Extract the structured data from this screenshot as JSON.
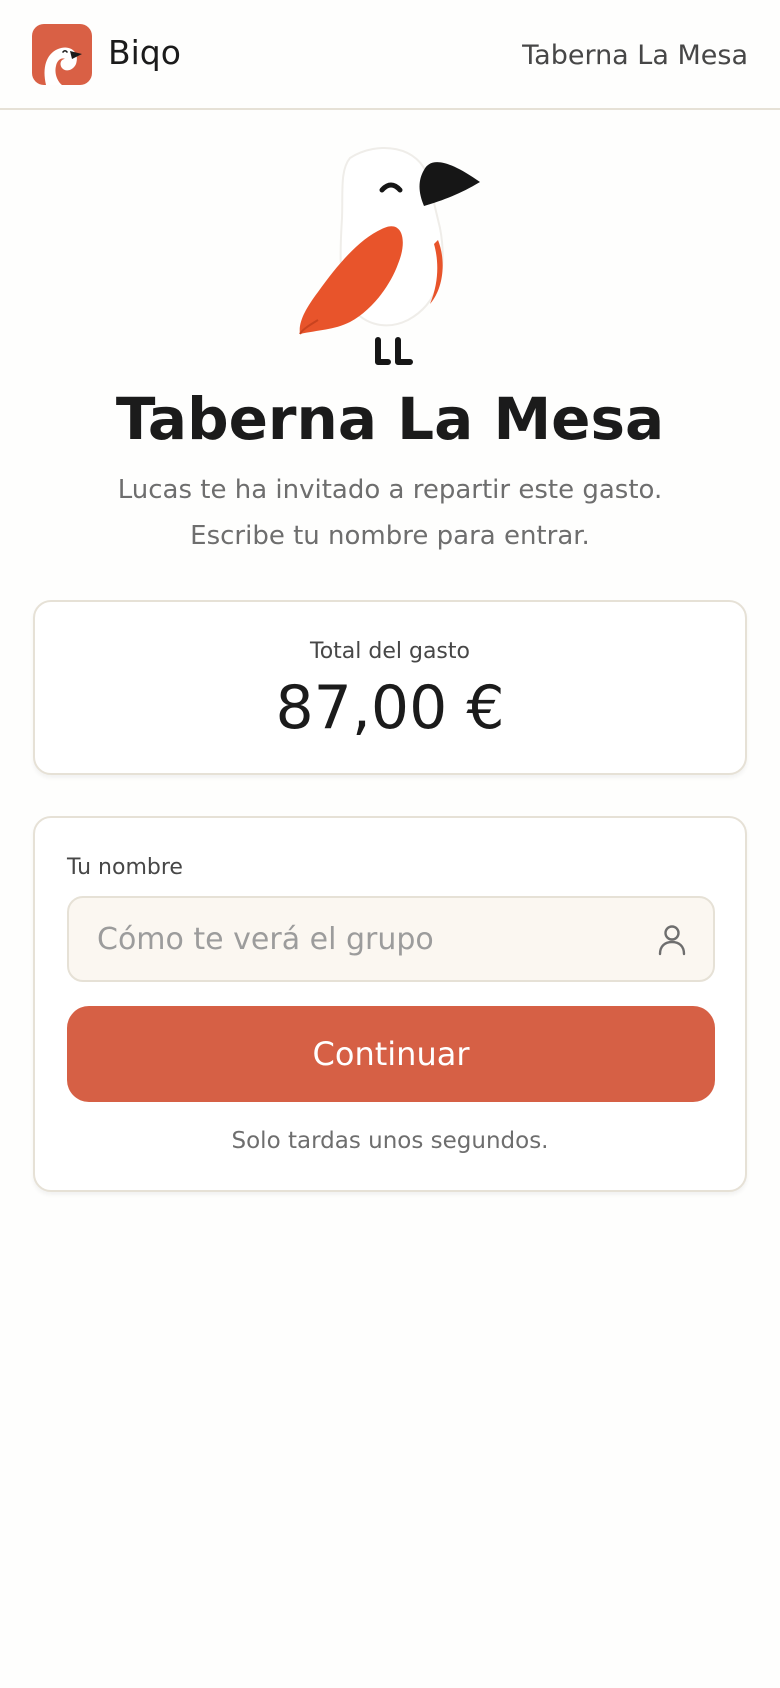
{
  "header": {
    "brand": "Biqo",
    "title": "Taberna La Mesa"
  },
  "hero": {
    "title": "Taberna La Mesa",
    "invite_line1": "Lucas te ha invitado a repartir este gasto.",
    "invite_line2": "Escribe tu nombre para entrar."
  },
  "total": {
    "label": "Total del gasto",
    "amount": "87,00 €"
  },
  "form": {
    "name_label": "Tu nombre",
    "name_placeholder": "Cómo te verá el grupo",
    "name_value": "",
    "continue_label": "Continuar",
    "hint": "Solo tardas unos segundos."
  },
  "icons": {
    "logo": "bird-logo-icon",
    "mascot": "bird-mascot-icon",
    "name_field": "user-icon"
  },
  "colors": {
    "accent": "#D66045",
    "background": "#FEFEFD",
    "card_border": "#E6E1D6",
    "input_background": "#FBF7F1",
    "text": "#1B1B1B",
    "muted_text": "#6E6E6E"
  }
}
